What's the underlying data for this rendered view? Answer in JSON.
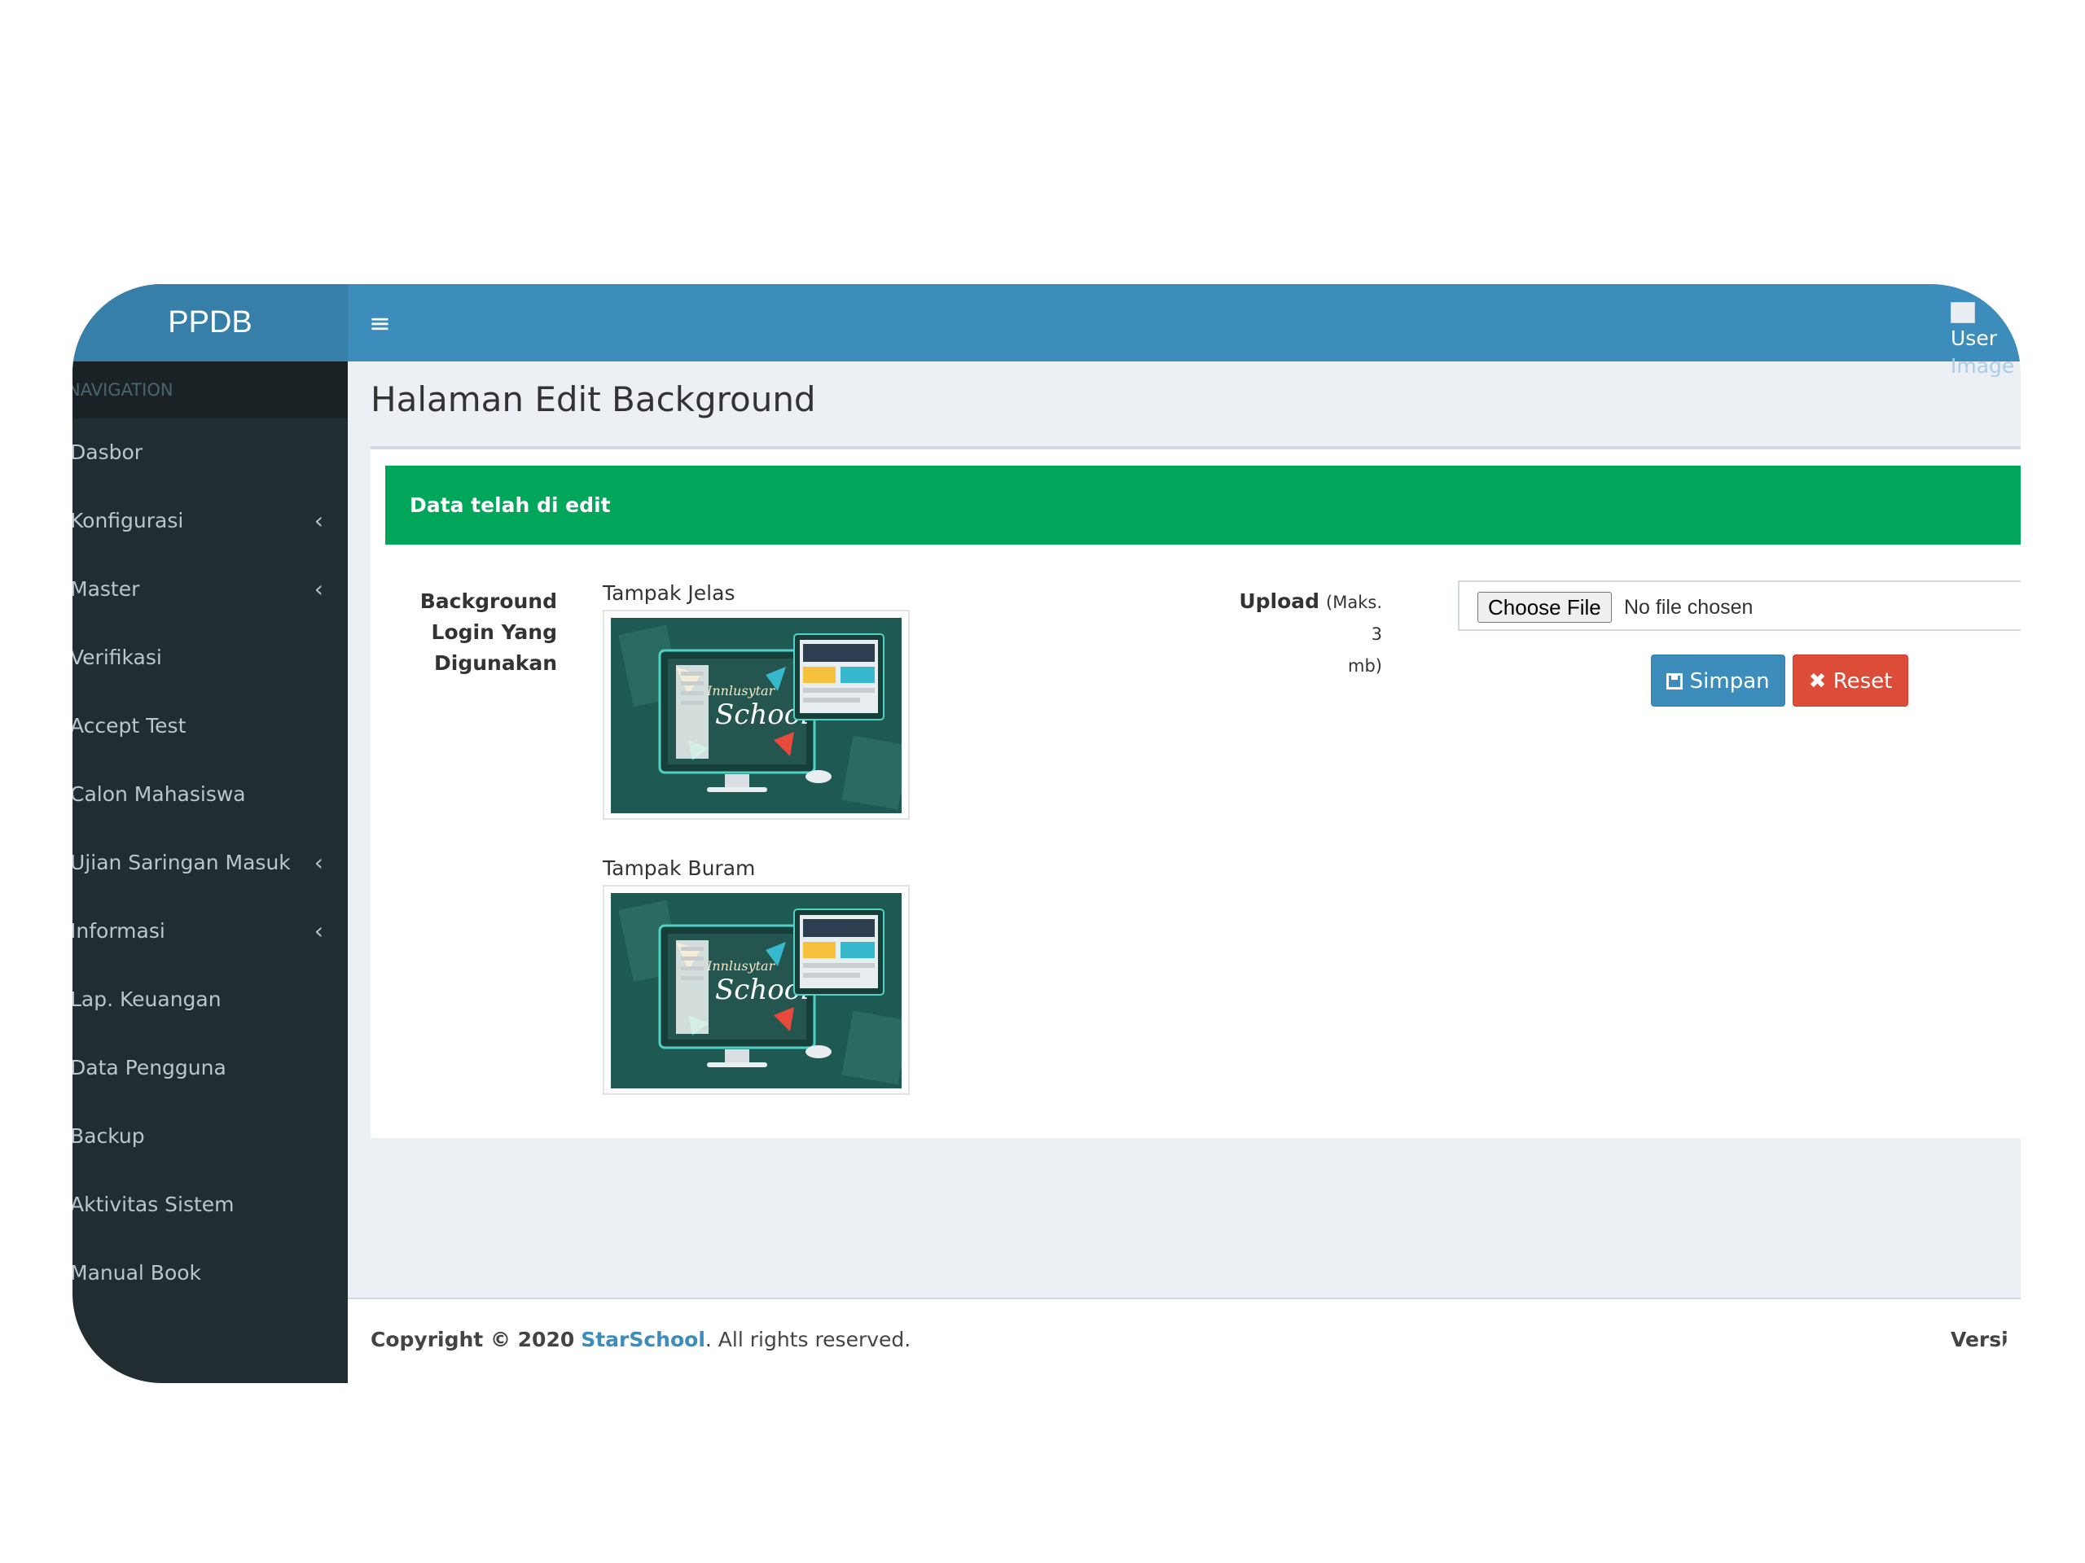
{
  "app": {
    "logo": "PPDB"
  },
  "sidebar": {
    "header": "NAVIGATION",
    "items": [
      {
        "label": "Dasbor",
        "has_submenu": false
      },
      {
        "label": "Konfigurasi",
        "has_submenu": true
      },
      {
        "label": "Master",
        "has_submenu": true
      },
      {
        "label": "Verifikasi",
        "has_submenu": false
      },
      {
        "label": "Accept Test",
        "has_submenu": false
      },
      {
        "label": "Calon Mahasiswa",
        "has_submenu": false
      },
      {
        "label": "Ujian Saringan Masuk",
        "has_submenu": true
      },
      {
        "label": "Informasi",
        "has_submenu": true
      },
      {
        "label": "Lap. Keuangan",
        "has_submenu": false
      },
      {
        "label": "Data Pengguna",
        "has_submenu": false
      },
      {
        "label": "Backup",
        "has_submenu": false
      },
      {
        "label": "Aktivitas Sistem",
        "has_submenu": false
      },
      {
        "label": "Manual Book",
        "has_submenu": false
      }
    ],
    "submenu_icon": "chevron-left-icon"
  },
  "topbar": {
    "menu_icon": "hamburger-icon",
    "user_image_alt_line1": "User",
    "user_image_alt_line2": "Image"
  },
  "page": {
    "title": "Halaman Edit Background"
  },
  "alert": {
    "message": "Data telah di edit",
    "color": "#00a65a"
  },
  "form": {
    "background_label_line1": "Background",
    "background_label_line2": "Login Yang",
    "background_label_line3": "Digunakan",
    "clear_caption": "Tampak Jelas",
    "blur_caption": "Tampak Buram",
    "upload_label": "Upload",
    "upload_hint_line1": "(Maks. 3",
    "upload_hint_line2": "mb)",
    "choose_file_label": "Choose File",
    "no_file_text": "No file chosen",
    "save_label": "Simpan",
    "reset_label": "Reset",
    "save_icon": "floppy-disk-icon",
    "reset_icon": "times-icon"
  },
  "preview_image": {
    "script_text": "Innlusytar",
    "title_text": "School"
  },
  "footer": {
    "copyright_prefix": "Copyright © 2020",
    "brand_link": "StarSchool",
    "copyright_suffix": ". All rights reserved.",
    "version_label": "Version"
  },
  "colors": {
    "primary": "#3c8dbc",
    "danger": "#dd4b39",
    "success": "#00a65a",
    "sidebar": "#222d32"
  }
}
